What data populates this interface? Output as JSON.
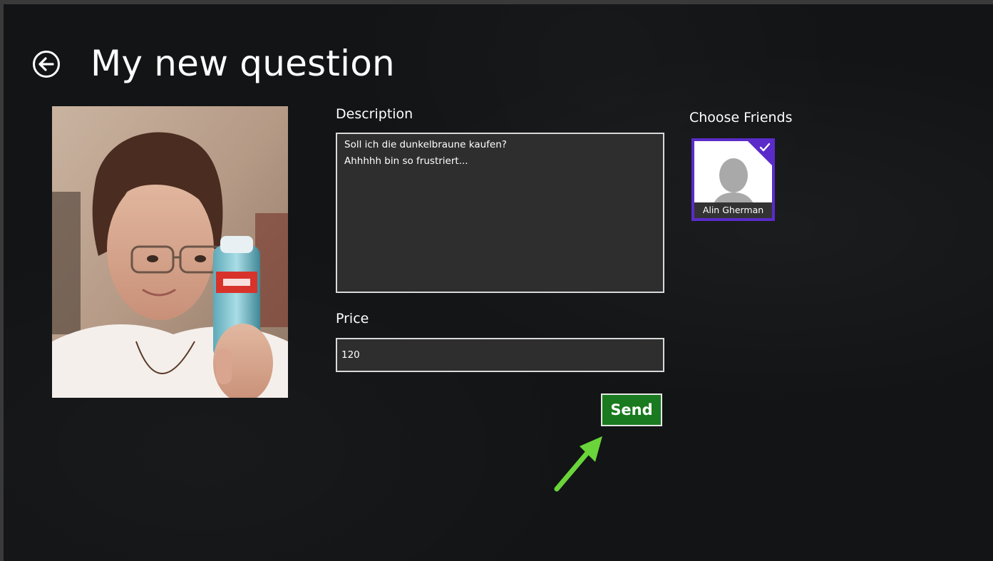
{
  "page": {
    "title": "My new question",
    "back_icon": "back-arrow-circle-icon"
  },
  "form": {
    "description_label": "Description",
    "description_value": "Soll ich die dunkelbraune kaufen?\nAhhhhh bin so frustriert...",
    "price_label": "Price",
    "price_value": "120",
    "send_label": "Send"
  },
  "friends": {
    "label": "Choose Friends",
    "items": [
      {
        "name": "Alin Gherman",
        "selected": true,
        "icon": "person-silhouette-icon"
      }
    ]
  },
  "colors": {
    "background": "#121416",
    "send_button": "#1a7a1f",
    "friend_selected": "#5a2bc9",
    "arrow": "#6ad43a"
  }
}
